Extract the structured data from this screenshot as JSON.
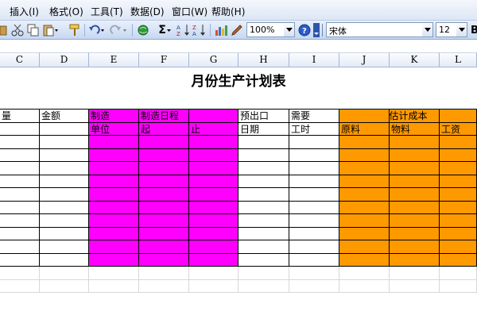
{
  "menu": [
    "插入(I)",
    "格式(O)",
    "工具(T)",
    "数据(D)",
    "窗口(W)",
    "帮助(H)"
  ],
  "toolbar": {
    "sigma": "Σ",
    "zoom": "100%",
    "font_name": "宋体",
    "font_size": "12",
    "bold": "B",
    "icons": [
      "paste-icon",
      "cut-icon",
      "copy-icon",
      "paste-special-icon",
      "format-painter-icon",
      "undo-icon",
      "redo-icon",
      "hyperlink-icon",
      "autosum-icon",
      "sort-asc-icon",
      "sort-desc-icon",
      "chart-wizard-icon",
      "help-icon"
    ]
  },
  "columns": [
    "C",
    "D",
    "E",
    "F",
    "G",
    "H",
    "I",
    "J",
    "K",
    "L"
  ],
  "sheet": {
    "title": "月份生产计划表",
    "headers": {
      "qty": "量",
      "amount": "金额",
      "make": "制造",
      "make_unit": "单位",
      "schedule": "制造日程",
      "start": "起",
      "end": "止",
      "expected": "预出口",
      "date": "日期",
      "need": "需要",
      "hours": "工时",
      "cost": "估计成本",
      "material": "原料",
      "supplies": "物料",
      "wage": "工资"
    },
    "fill_colors": {
      "magenta": "#ff00ff",
      "orange": "#ff9900"
    }
  }
}
